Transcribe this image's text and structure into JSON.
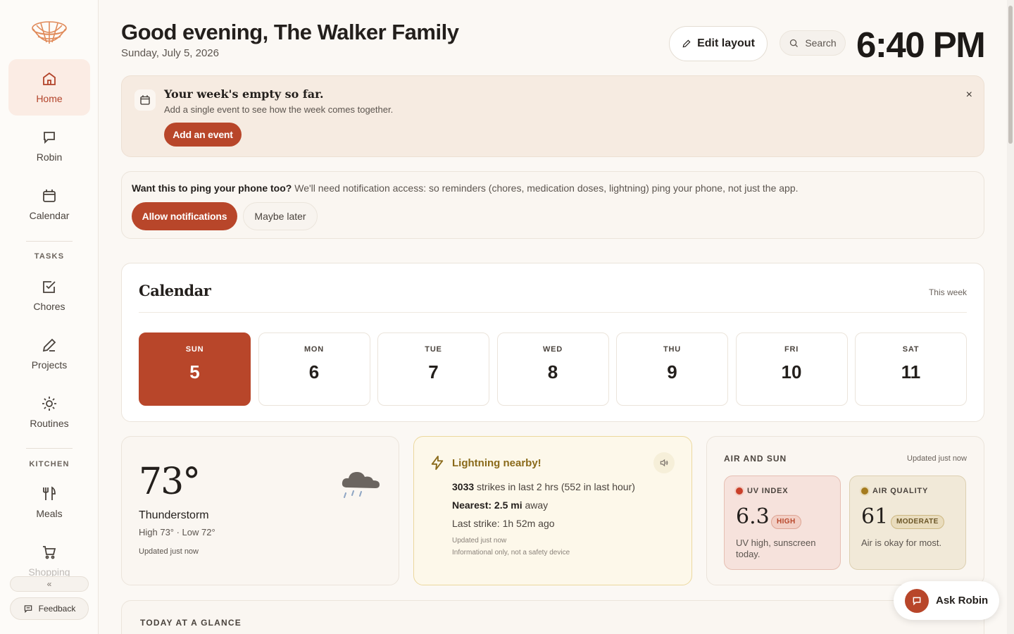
{
  "sidebar": {
    "items": [
      {
        "label": "Home",
        "icon": "home-icon"
      },
      {
        "label": "Robin",
        "icon": "chat-icon"
      },
      {
        "label": "Calendar",
        "icon": "calendar-icon"
      },
      {
        "label": "Chores",
        "icon": "checkbox-icon"
      },
      {
        "label": "Projects",
        "icon": "pencil-icon"
      },
      {
        "label": "Routines",
        "icon": "sun-icon"
      },
      {
        "label": "Meals",
        "icon": "utensils-icon"
      },
      {
        "label": "Shopping",
        "icon": "cart-icon"
      }
    ],
    "sections": {
      "tasks": "TASKS",
      "kitchen": "KITCHEN"
    },
    "collapse_label": "«",
    "feedback_label": "Feedback"
  },
  "header": {
    "greeting": "Good evening, The Walker Family",
    "date": "Sunday, July 5, 2026",
    "edit_label": "Edit layout",
    "search_label": "Search",
    "time": "6:40 PM"
  },
  "empty_banner": {
    "title": "Your week's empty so far.",
    "subtitle": "Add a single event to see how the week comes together.",
    "button": "Add an event",
    "close": "×"
  },
  "notifications": {
    "question": "Want this to ping your phone too?",
    "detail": " We'll need notification access: so reminders (chores, medication doses, lightning) ping your phone, not just the app.",
    "allow": "Allow notifications",
    "later": "Maybe later"
  },
  "calendar": {
    "title": "Calendar",
    "range": "This week",
    "days": [
      {
        "name": "SUN",
        "num": "5"
      },
      {
        "name": "MON",
        "num": "6"
      },
      {
        "name": "TUE",
        "num": "7"
      },
      {
        "name": "WED",
        "num": "8"
      },
      {
        "name": "THU",
        "num": "9"
      },
      {
        "name": "FRI",
        "num": "10"
      },
      {
        "name": "SAT",
        "num": "11"
      }
    ]
  },
  "weather": {
    "temp": "73°",
    "condition": "Thunderstorm",
    "hilo": "High 73° · Low 72°",
    "updated": "Updated just now"
  },
  "lightning": {
    "title": "Lightning nearby!",
    "strikes_count": "3033",
    "strikes_rest": " strikes in last 2 hrs (552 in last hour)",
    "nearest_label": "Nearest: 2.5 mi",
    "nearest_rest": " away",
    "last_strike": "Last strike: 1h 52m ago",
    "updated": "Updated just now",
    "disclaimer": "Informational only, not a safety device"
  },
  "air": {
    "title": "AIR AND SUN",
    "updated": "Updated just now",
    "uv": {
      "label": "UV INDEX",
      "value": "6.3",
      "badge": "HIGH",
      "desc": "UV high, sunscreen today.",
      "color": "#c9402a"
    },
    "aq": {
      "label": "AIR QUALITY",
      "value": "61",
      "badge": "MODERATE",
      "desc": "Air is okay for most.",
      "color": "#a57b1e"
    }
  },
  "glance": {
    "title": "TODAY AT A GLANCE"
  },
  "ask_robin": {
    "label": "Ask Robin"
  },
  "colors": {
    "accent": "#b8462a",
    "background": "#fbf8f4"
  }
}
